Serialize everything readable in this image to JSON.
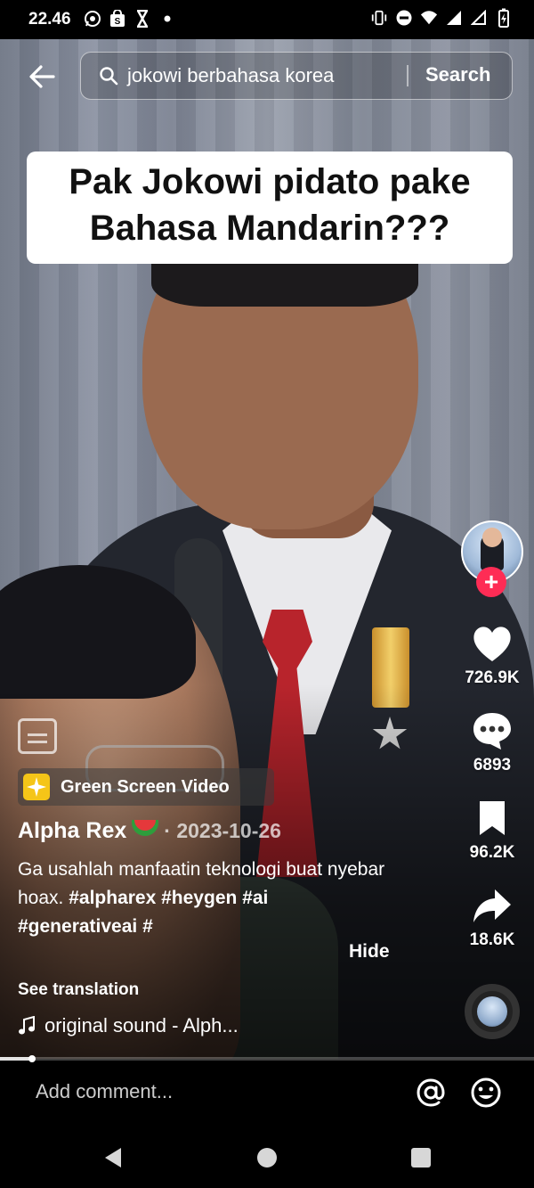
{
  "status_bar": {
    "time": "22.46",
    "left_icons": [
      "whatsapp-icon",
      "shopee-icon",
      "hourglass-icon",
      "dot-icon"
    ],
    "right_icons": [
      "vibrate-icon",
      "do-not-disturb-icon",
      "wifi-icon",
      "signal-icon",
      "signal-empty-icon",
      "battery-charging-icon"
    ]
  },
  "search": {
    "query": "jokowi berbahasa korea",
    "button_label": "Search"
  },
  "caption": {
    "line1": "Pak Jokowi pidato pake",
    "line2": "Bahasa Mandarin???"
  },
  "rail": {
    "likes": "726.9K",
    "comments": "6893",
    "saves": "96.2K",
    "shares": "18.6K",
    "follow_glyph": "+"
  },
  "effect": {
    "label": "Green Screen Video"
  },
  "post": {
    "author": "Alpha Rex",
    "date": "· 2023-10-26",
    "text_plain": "Ga usahlah manfaatin teknologi buat nyebar hoax. ",
    "hashtags": [
      "#alpharex",
      "#heygen",
      "#ai",
      "#generativeai",
      "#"
    ],
    "hide_label": "Hide",
    "see_translation": "See translation",
    "sound": "original sound - Alph..."
  },
  "progress": {
    "fraction": 0.06
  },
  "comment": {
    "placeholder": "Add comment..."
  },
  "colors": {
    "follow": "#fe2c55",
    "effect_icon": "#f5c518"
  }
}
